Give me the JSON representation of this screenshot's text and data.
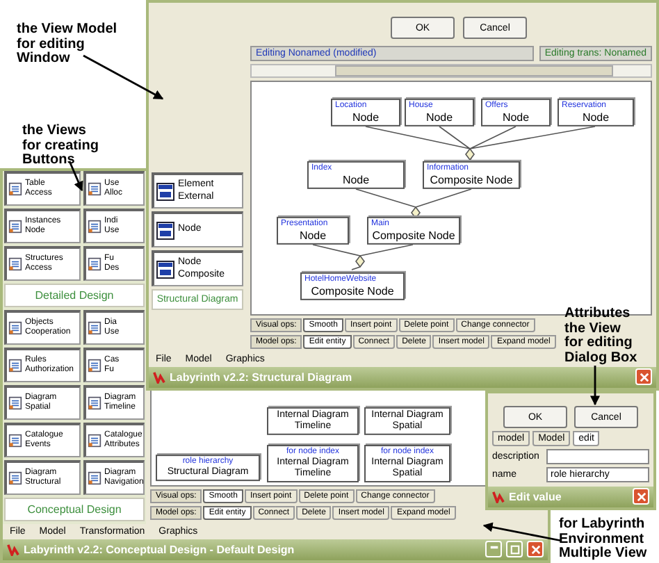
{
  "background_window": {
    "title": "Labyrinth v2.2: Conceptual Design - Default Design",
    "menu": [
      "File",
      "Model",
      "Transformation",
      "Graphics"
    ],
    "palette": [
      {
        "heading": "Detailed Design",
        "buttons": [
          {
            "lines": [
              "Table",
              "Access"
            ]
          },
          {
            "lines": [
              "Use",
              "Alloc"
            ]
          },
          {
            "lines": [
              "Instances",
              "Node"
            ]
          },
          {
            "lines": [
              "Indi",
              "Use"
            ]
          },
          {
            "lines": [
              "Structures",
              "Access"
            ]
          },
          {
            "lines": [
              "Fu",
              "Des"
            ]
          }
        ]
      },
      {
        "heading": "Conceptual Design",
        "buttons": [
          {
            "lines": [
              "Objects",
              "Cooperation"
            ]
          },
          {
            "lines": [
              "Dia",
              "Use"
            ]
          },
          {
            "lines": [
              "Rules",
              "Authorization"
            ]
          },
          {
            "lines": [
              "Cas",
              "Fu"
            ]
          },
          {
            "lines": [
              "Diagram",
              "Spatial"
            ]
          },
          {
            "lines": [
              "Diagram",
              "Timeline"
            ]
          },
          {
            "lines": [
              "Catalogue",
              "Events"
            ]
          },
          {
            "lines": [
              "Catalogue",
              "Attributes"
            ]
          },
          {
            "lines": [
              "Diagram",
              "Structural"
            ]
          },
          {
            "lines": [
              "Diagram",
              "Navigation"
            ]
          }
        ]
      }
    ],
    "toolbar_rows": [
      {
        "label": "Visual ops:",
        "tabs": [
          {
            "label": "Smooth",
            "selected": true
          },
          {
            "label": "Insert point",
            "selected": false
          },
          {
            "label": "Delete point",
            "selected": false
          },
          {
            "label": "Change connector",
            "selected": false
          }
        ]
      },
      {
        "label": "Model ops:",
        "tabs": [
          {
            "label": "Edit entity",
            "selected": true
          },
          {
            "label": "Connect",
            "selected": false
          },
          {
            "label": "Delete",
            "selected": false
          },
          {
            "label": "Insert model",
            "selected": false
          },
          {
            "label": "Expand model",
            "selected": false
          }
        ]
      }
    ],
    "canvas_nodes": [
      {
        "lines": [
          "Internal Diagram",
          "Timeline"
        ]
      },
      {
        "lines": [
          "Internal Diagram",
          "Spatial"
        ]
      },
      {
        "note": "role hierarchy",
        "lines": [
          "Structural Diagram"
        ]
      },
      {
        "note": "for node index",
        "lines": [
          "Internal Diagram",
          "Timeline"
        ]
      },
      {
        "note": "for node index",
        "lines": [
          "Internal Diagram",
          "Spatial"
        ]
      }
    ]
  },
  "edit_dialog": {
    "title": "Edit value",
    "buttons": [
      "OK",
      "Cancel"
    ],
    "tabs": [
      {
        "label": "model",
        "selected": false
      },
      {
        "label": "Model",
        "selected": false
      },
      {
        "label": "edit",
        "selected": true
      }
    ],
    "fields": [
      {
        "label": "description"
      },
      {
        "label": "name",
        "value": "role hierarchy"
      }
    ]
  },
  "structure_window": {
    "buttons": [
      "OK",
      "Cancel"
    ],
    "status": {
      "left": "Editing Nonamed (modified)",
      "right": "Editing trans: Nonamed"
    },
    "canvas_nodes": [
      {
        "note": "Location",
        "lines": [
          "Node"
        ]
      },
      {
        "note": "House",
        "lines": [
          "Node"
        ]
      },
      {
        "note": "Offers",
        "lines": [
          "Node"
        ]
      },
      {
        "note": "Reservation",
        "lines": [
          "Node"
        ]
      },
      {
        "note": "Index",
        "lines": [
          "Node"
        ]
      },
      {
        "note": "Information",
        "lines": [
          "Composite Node"
        ]
      },
      {
        "note": "Presentation",
        "lines": [
          "Node"
        ]
      },
      {
        "note": "Main",
        "lines": [
          "Composite Node"
        ]
      },
      {
        "note": "HotelHomeWebsite",
        "lines": [
          "Composite Node"
        ]
      }
    ],
    "palette": {
      "buttons": [
        {
          "lines": [
            "Element",
            "External"
          ]
        },
        {
          "lines": [
            "Node"
          ]
        },
        {
          "lines": [
            "Node",
            "Composite"
          ]
        }
      ],
      "heading": "Structural Diagram"
    },
    "toolbar_rows": [
      {
        "label": "Visual ops:",
        "tabs": [
          {
            "label": "Smooth",
            "selected": true
          },
          {
            "label": "Insert point",
            "selected": false
          },
          {
            "label": "Delete point",
            "selected": false
          },
          {
            "label": "Change connector",
            "selected": false
          }
        ]
      },
      {
        "label": "Model ops:",
        "tabs": [
          {
            "label": "Edit entity",
            "selected": true
          },
          {
            "label": "Connect",
            "selected": false
          },
          {
            "label": "Delete",
            "selected": false
          },
          {
            "label": "Insert model",
            "selected": false
          },
          {
            "label": "Expand model",
            "selected": false
          }
        ]
      }
    ],
    "menu": [
      "File",
      "Model",
      "Graphics"
    ],
    "title": "Labyrinth v2.2: Structural Diagram"
  },
  "annotations": [
    {
      "lines": [
        "the View Model",
        "for editing",
        "Window"
      ]
    },
    {
      "lines": [
        "the Views",
        "for creating",
        "Buttons"
      ]
    },
    {
      "lines": [
        "Attributes",
        "the View",
        "for editing",
        "Dialog Box"
      ]
    },
    {
      "lines": [
        "for Labyrinth",
        "Environment",
        "Multiple View"
      ]
    }
  ]
}
